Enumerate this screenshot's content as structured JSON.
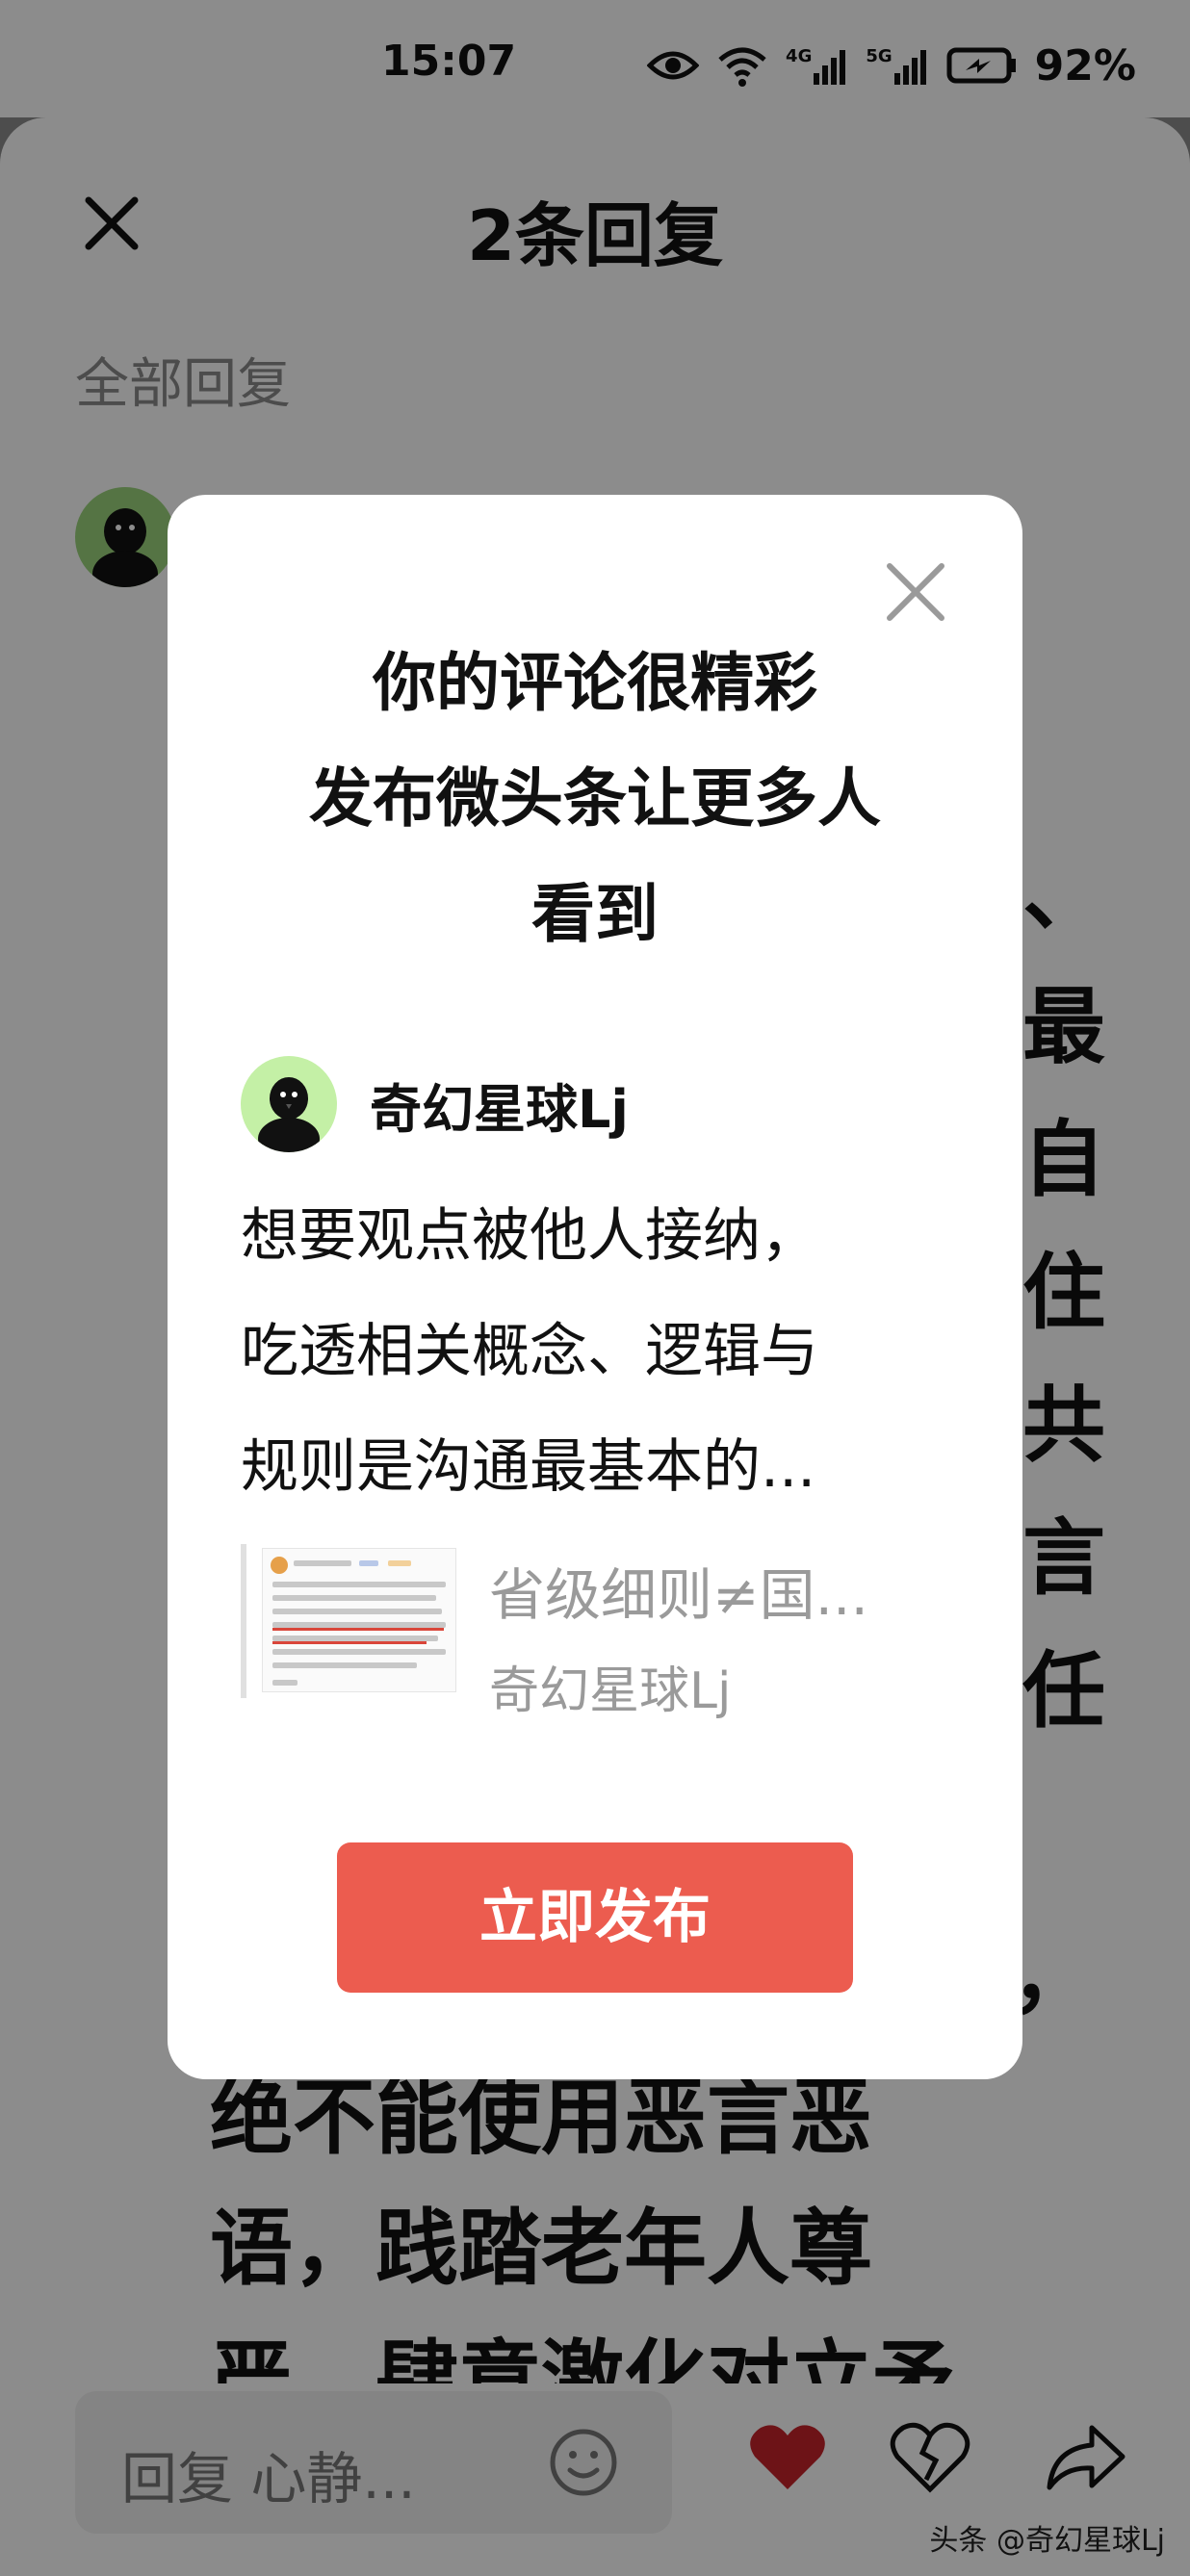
{
  "status_bar": {
    "time": "15:07",
    "signal_1": "4G",
    "signal_2": "5G",
    "battery": "92%"
  },
  "sheet": {
    "title": "2条回复",
    "subtitle": "全部回复",
    "right_chars": [
      "、",
      "最",
      "自",
      "住",
      "共",
      "言",
      "任"
    ],
    "comma_bottom": "，",
    "body_lines": [
      "绝不能使用恶言恶",
      "语，践踏老年人尊",
      "严，肆意激化对立矛"
    ]
  },
  "bottom_bar": {
    "reply_placeholder": "回复 心静...",
    "watermark": "头条 @奇幻星球Lj"
  },
  "dialog": {
    "headline": [
      "你的评论很精彩",
      "发布微头条让更多人",
      "看到"
    ],
    "user_name": "奇幻星球Lj",
    "post_lines": [
      "想要观点被他人接纳，",
      "吃透相关概念、逻辑与",
      "规则是沟通最基本的..."
    ],
    "quote_title": "省级细则≠国...",
    "quote_author": "奇幻星球Lj",
    "publish_label": "立即发布"
  },
  "colors": {
    "accent": "#ec5c4f",
    "heart": "#c6242b",
    "avatar_bg": "#c4f0a6"
  }
}
